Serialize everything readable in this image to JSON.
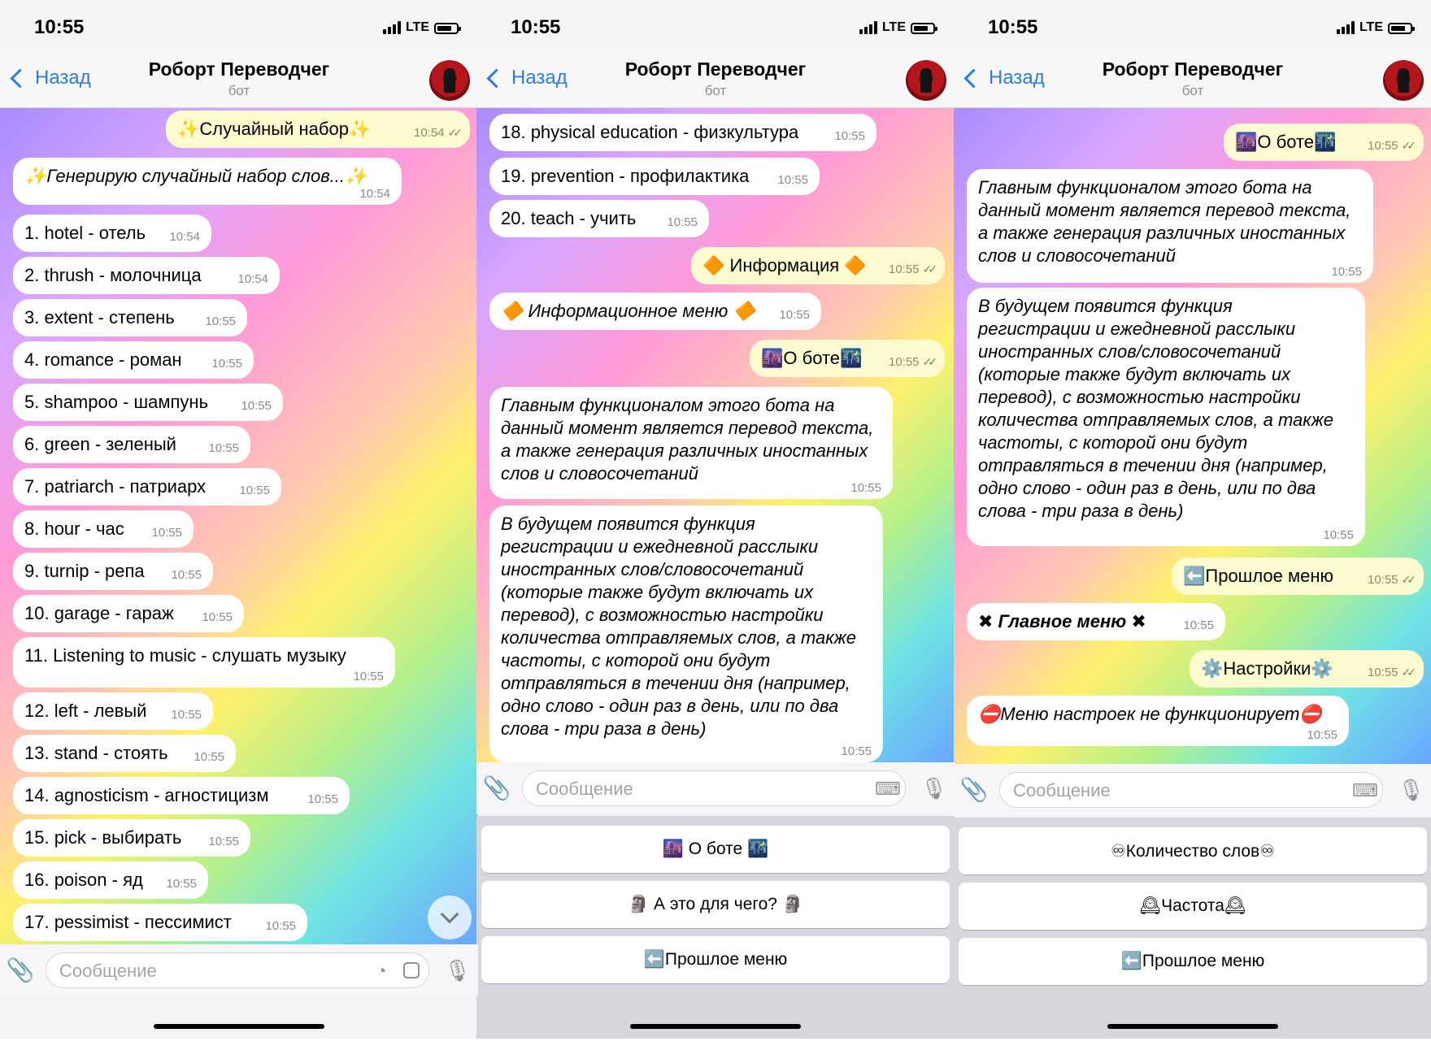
{
  "status": {
    "time": "10:55",
    "network": "LTE"
  },
  "header": {
    "back_label": "Назад",
    "title": "Роборт Переводчег",
    "subtitle": "бот"
  },
  "input": {
    "placeholder": "Сообщение"
  },
  "screens": [
    {
      "messages": [
        {
          "text": "✨Случайный набор✨",
          "time": "10:54",
          "dir": "out"
        },
        {
          "text": "✨Генерирую случайный набор слов...✨",
          "time": "10:54",
          "dir": "in"
        },
        {
          "text": "1. hotel - отель",
          "time": "10:54",
          "dir": "in"
        },
        {
          "text": "2. thrush - молочница",
          "time": "10:54",
          "dir": "in"
        },
        {
          "text": "3. extent - степень",
          "time": "10:55",
          "dir": "in"
        },
        {
          "text": "4. romance - роман",
          "time": "10:55",
          "dir": "in"
        },
        {
          "text": "5. shampoo - шампунь",
          "time": "10:55",
          "dir": "in"
        },
        {
          "text": "6. green - зеленый",
          "time": "10:55",
          "dir": "in"
        },
        {
          "text": "7. patriarch - патриарх",
          "time": "10:55",
          "dir": "in"
        },
        {
          "text": "8. hour - час",
          "time": "10:55",
          "dir": "in"
        },
        {
          "text": "9. turnip - репа",
          "time": "10:55",
          "dir": "in"
        },
        {
          "text": "10. garage - гараж",
          "time": "10:55",
          "dir": "in"
        },
        {
          "text": "11. Listening to music - слушать музыку",
          "time": "10:55",
          "dir": "in"
        },
        {
          "text": "12. left - левый",
          "time": "10:55",
          "dir": "in"
        },
        {
          "text": "13. stand - стоять",
          "time": "10:55",
          "dir": "in"
        },
        {
          "text": "14. agnosticism - агностицизм",
          "time": "10:55",
          "dir": "in"
        },
        {
          "text": "15. pick - выбирать",
          "time": "10:55",
          "dir": "in"
        },
        {
          "text": "16. poison - яд",
          "time": "10:55",
          "dir": "in"
        },
        {
          "text": "17. pessimist - пессимист",
          "time": "10:55",
          "dir": "in"
        }
      ]
    },
    {
      "messages": [
        {
          "text": "18. physical education - физкультура",
          "time": "10:55",
          "dir": "in"
        },
        {
          "text": "19. prevention - профилактика",
          "time": "10:55",
          "dir": "in"
        },
        {
          "text": "20. teach - учить",
          "time": "10:55",
          "dir": "in"
        },
        {
          "text": "🔶 Информация 🔶",
          "time": "10:55",
          "dir": "out"
        },
        {
          "text": "🔶 Информационное меню 🔶",
          "time": "10:55",
          "dir": "in"
        },
        {
          "text": "🌆О боте🌃",
          "time": "10:55",
          "dir": "out"
        },
        {
          "lines": [
            "Главным функционалом этого бота на",
            "данный момент является перевод текста,",
            "а также генерация различных иностанных",
            "слов и словосочетаний"
          ],
          "time": "10:55",
          "dir": "in"
        },
        {
          "lines": [
            "В будущем появится функция",
            "регистрации и ежедневной расслыки",
            "иностранных слов/словосочетаний",
            "(которые также будут включать их",
            "перевод), с возможностью настройки",
            "количества отправляемых слов, а также",
            "частоты, с которой они будут",
            "отправляться в течении дня (например,",
            "одно слово - один раз в день, или по два",
            "слова - три раза в день)"
          ],
          "time": "10:55",
          "dir": "in"
        }
      ],
      "keyboard": [
        "🌆 О боте 🌃",
        "🗿 А это для чего? 🗿",
        "⬅️Прошлое меню"
      ]
    },
    {
      "messages": [
        {
          "text": "🌆О боте🌃",
          "time": "10:55",
          "dir": "out"
        },
        {
          "lines": [
            "Главным функционалом этого бота на",
            "данный момент является перевод текста,",
            "а также генерация различных иностанных",
            "слов и словосочетаний"
          ],
          "time": "10:55",
          "dir": "in"
        },
        {
          "lines": [
            "В будущем появится функция",
            "регистрации и ежедневной расслыки",
            "иностранных слов/словосочетаний",
            "(которые также будут включать их",
            "перевод), с возможностью настройки",
            "количества отправляемых слов, а также",
            "частоты, с которой они будут",
            "отправляться в течении дня (например,",
            "одно слово - один раз в день, или по два",
            "слова - три раза в день)"
          ],
          "time": "10:55",
          "dir": "in"
        },
        {
          "text": "⬅️Прошлое меню",
          "time": "10:55",
          "dir": "out"
        },
        {
          "text": "✖ Главное меню ✖",
          "time": "10:55",
          "dir": "in"
        },
        {
          "text": "⚙️Настройки⚙️",
          "time": "10:55",
          "dir": "out"
        },
        {
          "text": "⛔Меню настроек не функционирует⛔",
          "time": "10:55",
          "dir": "in"
        }
      ],
      "keyboard": [
        "♾Количество слов♾",
        "🕰Частота🕰",
        "⬅️Прошлое меню"
      ]
    }
  ],
  "colors": {
    "link": "#2b7ce0",
    "outgoing_bubble": "#fffbd0",
    "incoming_bubble": "#ffffff",
    "keyboard_bg": "#d6d7dc"
  }
}
